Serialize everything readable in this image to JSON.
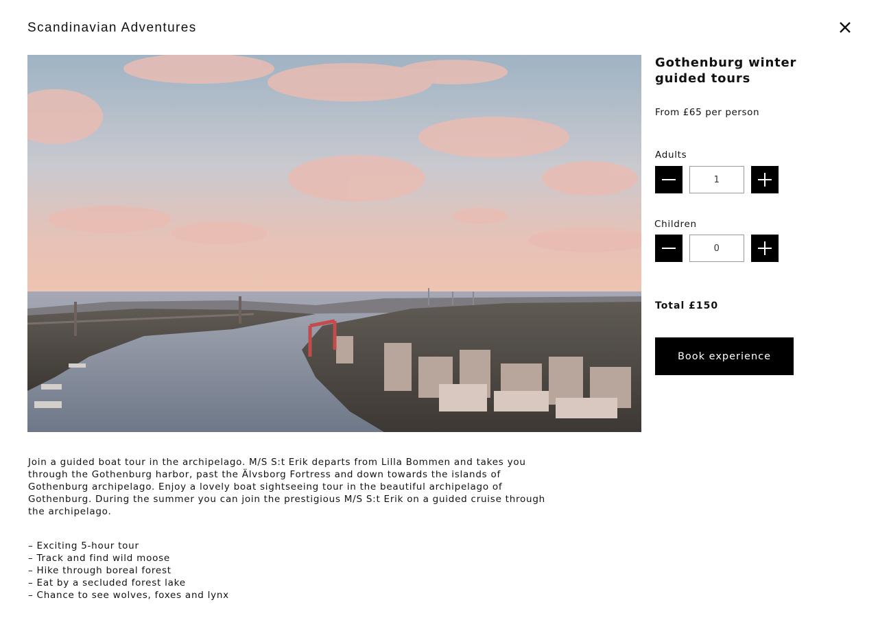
{
  "brand": "Scandinavian Adventures",
  "icons": {
    "close": "close-icon",
    "minus": "minus-icon",
    "plus": "plus-icon"
  },
  "hero_image": {
    "description_icon": "photo"
  },
  "experience": {
    "title": "Gothenburg winter guided tours",
    "price": "From £65 per person"
  },
  "booking": {
    "adults_label": "Adults",
    "adults_value": "1",
    "children_label": "Children",
    "children_value": "0",
    "total": "Total £150",
    "book_label": "Book experience"
  },
  "description": "Join a guided boat tour in the archipelago. M/S S:t Erik departs from Lilla Bommen and takes you through the Gothenburg harbor, past the Älvsborg Fortress and down towards the islands of Gothenburg archipelago. Enjoy a lovely boat sightseeing tour in the beautiful archipelago of Gothenburg. During the summer you can join the prestigious M/S S:t Erik on a guided cruise through the archipelago.",
  "features": [
    "– Exciting 5-hour tour",
    "– Track and find wild moose",
    "– Hike through boreal forest",
    "– Eat by a secluded forest lake",
    "– Chance to see wolves, foxes and lynx"
  ],
  "colors": {
    "background": "#ffffff",
    "text": "#111111",
    "button": "#000000",
    "button_text": "#ffffff"
  }
}
